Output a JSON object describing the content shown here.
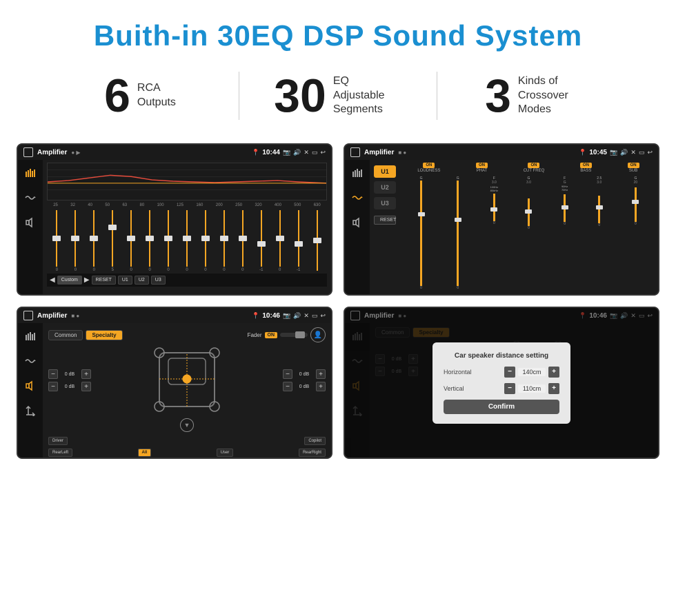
{
  "page": {
    "title": "Buith-in 30EQ DSP Sound System"
  },
  "stats": [
    {
      "number": "6",
      "label": "RCA\nOutputs"
    },
    {
      "number": "30",
      "label": "EQ Adjustable\nSegments"
    },
    {
      "number": "3",
      "label": "Kinds of\nCrossover Modes"
    }
  ],
  "screens": [
    {
      "id": "eq-screen",
      "title": "Amplifier",
      "time": "10:44",
      "type": "eq"
    },
    {
      "id": "crossover-screen",
      "title": "Amplifier",
      "time": "10:45",
      "type": "crossover"
    },
    {
      "id": "fader-screen",
      "title": "Amplifier",
      "time": "10:46",
      "type": "fader"
    },
    {
      "id": "dialog-screen",
      "title": "Amplifier",
      "time": "10:46",
      "type": "dialog"
    }
  ],
  "eq": {
    "freqs": [
      "25",
      "32",
      "40",
      "50",
      "63",
      "80",
      "100",
      "125",
      "160",
      "200",
      "250",
      "320",
      "400",
      "500",
      "630"
    ],
    "values": [
      "0",
      "0",
      "0",
      "5",
      "0",
      "0",
      "0",
      "0",
      "0",
      "0",
      "0",
      "-1",
      "0",
      "-1",
      ""
    ],
    "presets": [
      "Custom",
      "RESET",
      "U1",
      "U2",
      "U3"
    ]
  },
  "crossover": {
    "uButtons": [
      "U1",
      "U2",
      "U3"
    ],
    "channels": [
      "LOUDNESS",
      "PHAT",
      "CUT FREQ",
      "BASS",
      "SUB"
    ],
    "onLabels": [
      "ON",
      "ON",
      "ON",
      "ON",
      "ON"
    ]
  },
  "fader": {
    "tabs": [
      "Common",
      "Specialty"
    ],
    "activeTab": "Specialty",
    "faderLabel": "Fader",
    "onToggle": "ON",
    "volRows": [
      "0 dB",
      "0 dB",
      "0 dB",
      "0 dB"
    ],
    "bottomBtns": [
      "Driver",
      "",
      "Copilot",
      "RearLeft",
      "All",
      "User",
      "RearRight"
    ]
  },
  "dialog": {
    "title": "Car speaker distance setting",
    "fields": [
      {
        "label": "Horizontal",
        "value": "140cm"
      },
      {
        "label": "Vertical",
        "value": "110cm"
      }
    ],
    "confirm": "Confirm",
    "tabs": [
      "Common",
      "Specialty"
    ],
    "volRows": [
      "0 dB",
      "0 dB"
    ]
  }
}
